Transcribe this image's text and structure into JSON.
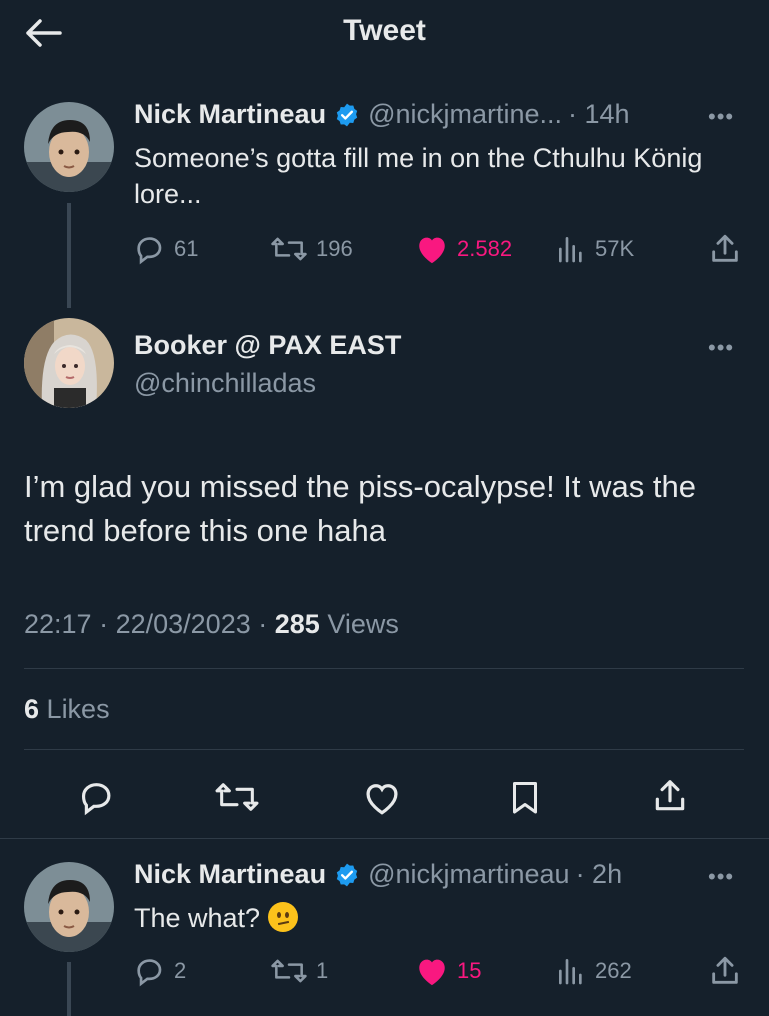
{
  "header": {
    "title": "Tweet",
    "back_icon": "arrow-left-icon"
  },
  "parent_tweet": {
    "name": "Nick Martineau",
    "handle": "@nickjmartine...",
    "time": "· 14h",
    "text": "Someone’s gotta fill me in on the Cthulhu König lore...",
    "replies": "61",
    "retweets": "196",
    "likes": "2.582",
    "views": "57K"
  },
  "main_tweet": {
    "name": "Booker @ PAX EAST",
    "handle": "@chinchilladas",
    "text": "I’m glad you missed the piss-ocalypse! It was the trend before this one haha",
    "time": "22:17",
    "date": "22/03/2023",
    "views_count": "285",
    "views_label": "Views",
    "likes_count": "6",
    "likes_label": "Likes"
  },
  "reply_tweet": {
    "name": "Nick Martineau",
    "handle": "@nickjmartineau",
    "time": "· 2h",
    "text": "The what?",
    "replies": "2",
    "retweets": "1",
    "likes": "15",
    "views": "262"
  },
  "colors": {
    "background": "#15202b",
    "verified": "#1d9bf0",
    "like": "#f91880",
    "muted": "#8b98a5"
  }
}
